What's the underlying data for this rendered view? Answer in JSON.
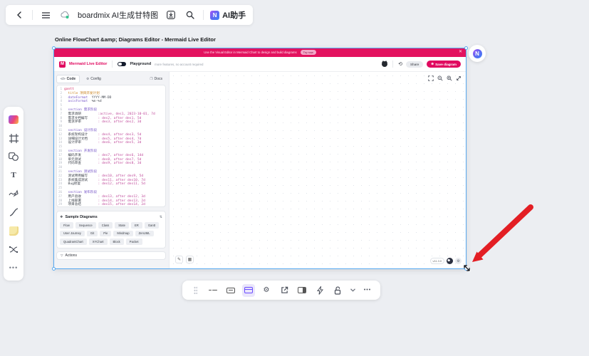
{
  "topbar": {
    "title": "boardmix AI生成甘特图",
    "ai_label": "AI助手",
    "icons": [
      "back",
      "menu",
      "cloud-sync",
      "download",
      "search",
      "ai-logo"
    ]
  },
  "sidebar": {
    "icons": [
      "assets",
      "frame",
      "shapes",
      "text",
      "pen",
      "connector",
      "sticky-note",
      "relation",
      "more"
    ]
  },
  "embed": {
    "page_title": "Online FlowChart &amp; Diagrams Editor - Mermaid Live Editor",
    "banner": {
      "text": "Use the Visual Editor in Mermaid Chart to design and build diagrams",
      "cta": "Try now",
      "close": "✕"
    },
    "header": {
      "brand": "Mermaid Live Editor",
      "mode": "Playground",
      "mode_note": "more features, no account required",
      "share_label": "Share",
      "save_label": "Save diagram",
      "icons": [
        "github",
        "history"
      ]
    },
    "tabs": {
      "code": "Code",
      "config": "Config",
      "docs": "Docs"
    },
    "code_lines": [
      [
        [
          "kw2",
          "gantt"
        ]
      ],
      [
        [
          "sp",
          "  "
        ],
        [
          "title",
          "title 项目开发计划"
        ]
      ],
      [
        [
          "sp",
          "  "
        ],
        [
          "attr",
          "dateFormat"
        ],
        [
          "val",
          "  YYYY-MM-DD"
        ]
      ],
      [
        [
          "sp",
          "  "
        ],
        [
          "attr",
          "axisFormat"
        ],
        [
          "val",
          "  %m-%d"
        ]
      ],
      [],
      [
        [
          "sp",
          "  "
        ],
        [
          "kw",
          "section "
        ],
        [
          "sec",
          "需求阶段"
        ]
      ],
      [
        [
          "sp",
          "  "
        ],
        [
          "name",
          "需求调研"
        ],
        [
          "meta",
          ":active, des1, 2023-10-01, 7d"
        ]
      ],
      [
        [
          "sp",
          "  "
        ],
        [
          "name",
          "需求文档编写"
        ],
        [
          "meta",
          ": des2, after des1, 5d"
        ]
      ],
      [
        [
          "sp",
          "  "
        ],
        [
          "name",
          "需求评审"
        ],
        [
          "meta",
          ": des3, after des2, 3d"
        ]
      ],
      [],
      [
        [
          "sp",
          "  "
        ],
        [
          "kw",
          "section "
        ],
        [
          "sec",
          "设计阶段"
        ]
      ],
      [
        [
          "sp",
          "  "
        ],
        [
          "name",
          "系统架构设计"
        ],
        [
          "meta",
          ": des4, after des3, 5d"
        ]
      ],
      [
        [
          "sp",
          "  "
        ],
        [
          "name",
          "详细设计文档"
        ],
        [
          "meta",
          ": des5, after des4, 7d"
        ]
      ],
      [
        [
          "sp",
          "  "
        ],
        [
          "name",
          "设计评审"
        ],
        [
          "meta",
          ": des6, after des5, 3d"
        ]
      ],
      [],
      [
        [
          "sp",
          "  "
        ],
        [
          "kw",
          "section "
        ],
        [
          "sec",
          "开发阶段"
        ]
      ],
      [
        [
          "sp",
          "  "
        ],
        [
          "name",
          "编码开发"
        ],
        [
          "meta",
          ": des7, after des6, 14d"
        ]
      ],
      [
        [
          "sp",
          "  "
        ],
        [
          "name",
          "单元测试"
        ],
        [
          "meta",
          ": des8, after des7, 5d"
        ]
      ],
      [
        [
          "sp",
          "  "
        ],
        [
          "name",
          "代码审查"
        ],
        [
          "meta",
          ": des9, after des8, 3d"
        ]
      ],
      [],
      [
        [
          "sp",
          "  "
        ],
        [
          "kw",
          "section "
        ],
        [
          "sec",
          "测试阶段"
        ]
      ],
      [
        [
          "sp",
          "  "
        ],
        [
          "name",
          "测试用例编写"
        ],
        [
          "meta",
          ": des10, after des9, 5d"
        ]
      ],
      [
        [
          "sp",
          "  "
        ],
        [
          "name",
          "系统集成测试"
        ],
        [
          "meta",
          ": des11, after des10, 7d"
        ]
      ],
      [
        [
          "sp",
          "  "
        ],
        [
          "name",
          "Bug修复"
        ],
        [
          "meta",
          ": des12, after des11, 5d"
        ]
      ],
      [],
      [
        [
          "sp",
          "  "
        ],
        [
          "kw",
          "section "
        ],
        [
          "sec",
          "发布阶段"
        ]
      ],
      [
        [
          "sp",
          "  "
        ],
        [
          "name",
          "用户验收"
        ],
        [
          "meta",
          ": des13, after des12, 3d"
        ]
      ],
      [
        [
          "sp",
          "  "
        ],
        [
          "name",
          "上线部署"
        ],
        [
          "meta",
          ": des14, after des13, 2d"
        ]
      ],
      [
        [
          "sp",
          "  "
        ],
        [
          "name",
          "项目总结"
        ],
        [
          "meta",
          ": des15, after des14, 2d"
        ]
      ]
    ],
    "samples": {
      "title": "Sample Diagrams",
      "chips": [
        "Flow",
        "Sequence",
        "Class",
        "State",
        "ER",
        "Gantt",
        "User Journey",
        "Git",
        "Pie",
        "Mindmap",
        "ZenUML",
        "QuadrantChart",
        "XYChart",
        "Block",
        "Packet"
      ]
    },
    "actions_label": "Actions",
    "statusbar": {
      "version": "v11.3.0"
    },
    "preview_icons": [
      "fit-view",
      "zoom-out",
      "zoom-in",
      "expand",
      "edit-pen",
      "grid",
      "theme-toggle",
      "settings"
    ]
  },
  "bottom_toolbar": {
    "icons": [
      "drag-handle",
      "dash-line",
      "address-bar",
      "browser-window",
      "settings-gear",
      "open-external",
      "side-panel",
      "flash",
      "unlock",
      "chevron-down",
      "more"
    ]
  },
  "colors": {
    "accent_pink": "#e0095f",
    "banner_pink": "#e3125f",
    "selection_blue": "#57a9f0",
    "arrow_red": "#e02424",
    "toolbar_active_purple": "#6b4dff",
    "canvas_bg": "#eceef2"
  }
}
